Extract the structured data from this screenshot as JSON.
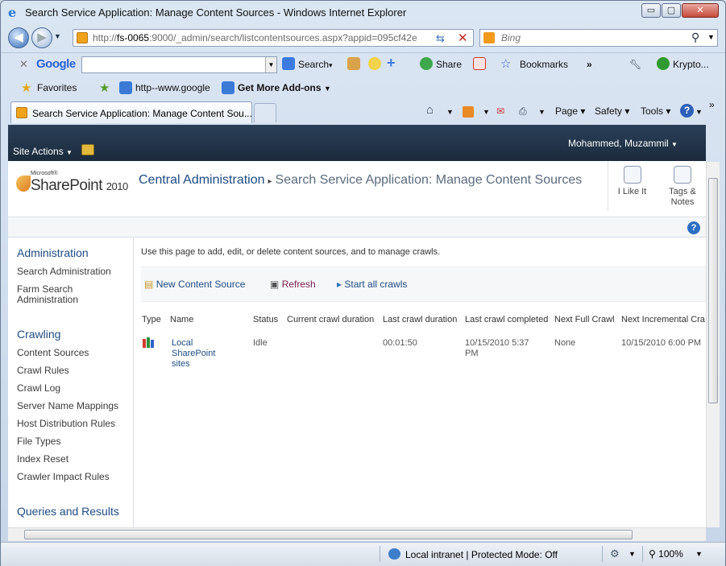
{
  "window": {
    "title": "Search Service Application: Manage Content Sources - Windows Internet Explorer",
    "min_label": "▭",
    "max_label": "▢",
    "close_label": "✕"
  },
  "addressbar": {
    "url_prefix": "http://",
    "url_host": "fs-0065",
    "url_rest": ":9000/_admin/search/listcontentsources.aspx?appid=095cf42e",
    "search_placeholder": "Bing"
  },
  "google_toolbar": {
    "logo": "Google",
    "search_label": "Search",
    "share_label": "Share",
    "bookmarks_label": "Bookmarks",
    "more_label": "»",
    "krypto_label": "Krypto..."
  },
  "favorites_bar": {
    "favorites_label": "Favorites",
    "link1": "http--www.google",
    "link2": "Get More Add-ons"
  },
  "tabs": {
    "active_label": "Search Service Application: Manage Content Sou..."
  },
  "commandbar": {
    "page": "Page",
    "safety": "Safety",
    "tools": "Tools",
    "more": "»"
  },
  "ribbon": {
    "site_actions": "Site Actions",
    "user": "Mohammed, Muzammil"
  },
  "titlearea": {
    "logo_ms": "Microsoft®",
    "logo_sp": "SharePoint",
    "logo_year": "2010",
    "breadcrumb_home": "Central Administration",
    "breadcrumb_page": "Search Service Application: Manage Content Sources",
    "ilikeit": "I Like It",
    "tags_notes": "Tags & Notes"
  },
  "leftnav": {
    "administration": "Administration",
    "search_admin": "Search Administration",
    "farm_search_admin": "Farm Search Administration",
    "crawling": "Crawling",
    "content_sources": "Content Sources",
    "crawl_rules": "Crawl Rules",
    "crawl_log": "Crawl Log",
    "server_name_mappings": "Server Name Mappings",
    "host_distribution_rules": "Host Distribution Rules",
    "file_types": "File Types",
    "index_reset": "Index Reset",
    "crawler_impact_rules": "Crawler Impact Rules",
    "queries_results": "Queries and Results"
  },
  "content": {
    "intro": "Use this page to add, edit, or delete content sources, and to manage crawls.",
    "new_content_source": "New Content Source",
    "refresh": "Refresh",
    "start_all_crawls": "Start all crawls",
    "columns": [
      "Type",
      "Name",
      "Status",
      "Current crawl duration",
      "Last crawl duration",
      "Last crawl completed",
      "Next Full Crawl",
      "Next Incremental Cra"
    ],
    "row": {
      "name": "Local SharePoint sites",
      "status": "Idle",
      "current_duration": "",
      "last_duration": "00:01:50",
      "last_completed": "10/15/2010 5:37 PM",
      "next_full": "None",
      "next_incremental": "10/15/2010 6:00 PM"
    }
  },
  "statusbar": {
    "zone": "Local intranet | Protected Mode: Off",
    "zoom": "100%"
  }
}
